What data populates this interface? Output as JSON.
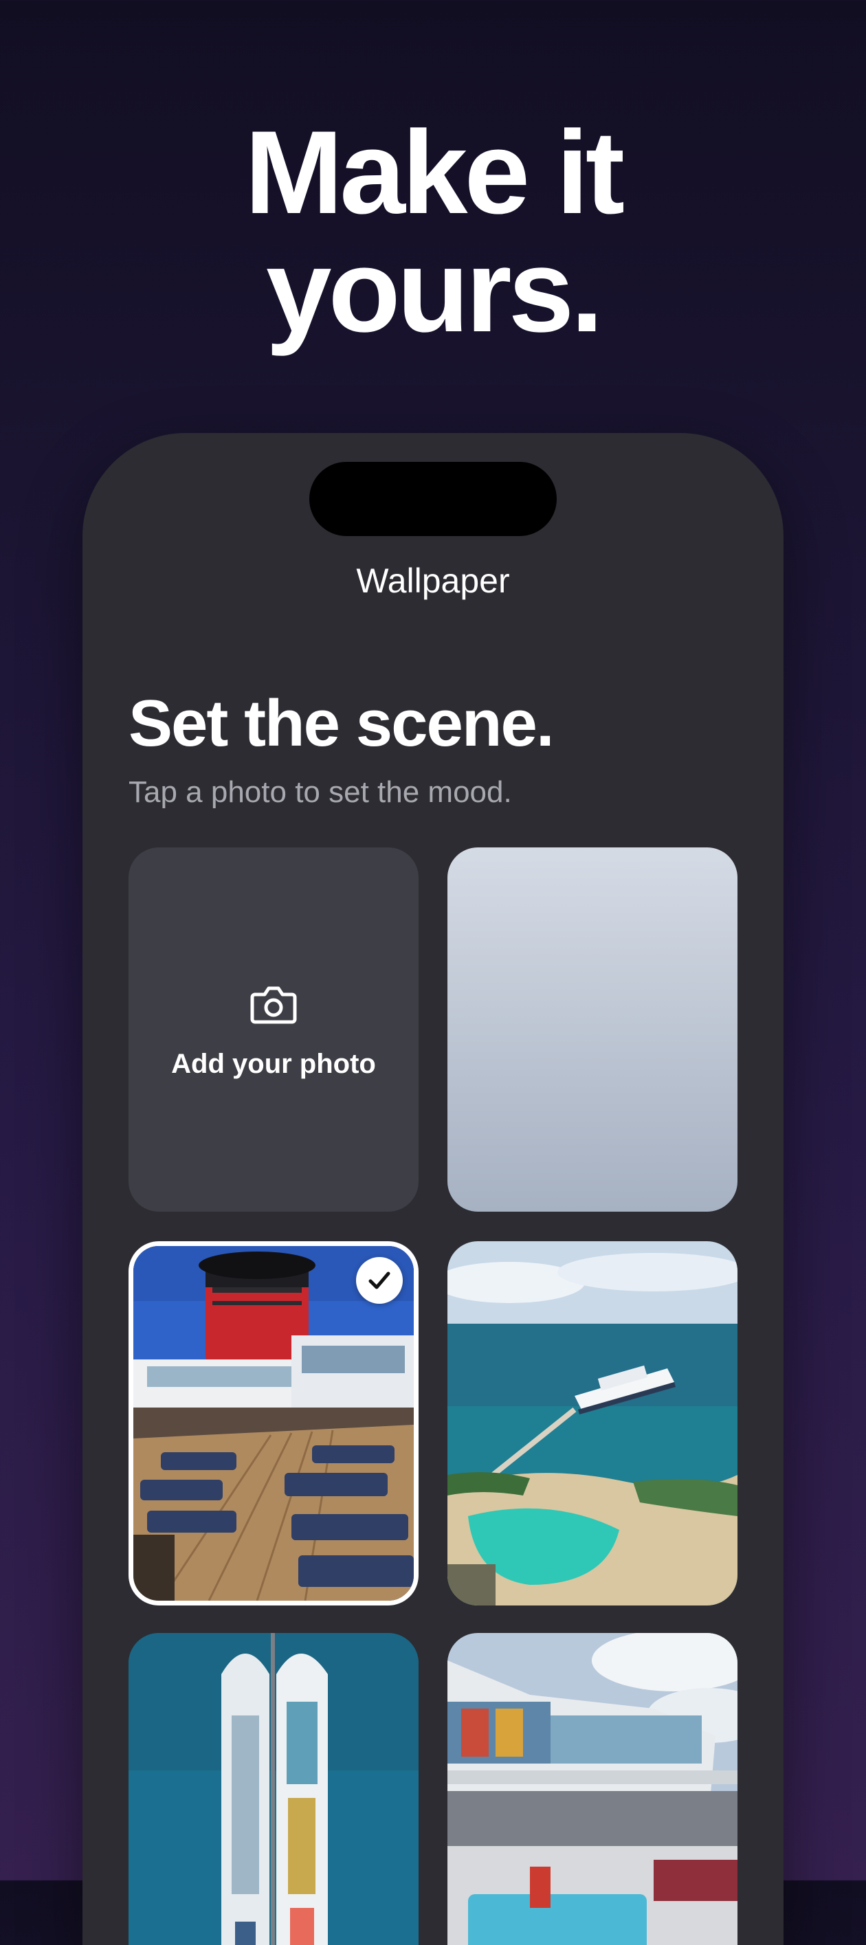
{
  "hero": {
    "line1": "Make it",
    "line2": "yours."
  },
  "screen": {
    "nav_title": "Wallpaper",
    "title": "Set the scene.",
    "subtitle": "Tap a photo to set the mood."
  },
  "tiles": [
    {
      "kind": "add-photo",
      "label": "Add your photo",
      "icon": "camera-icon"
    },
    {
      "kind": "gradient",
      "colors": [
        "#d5dbe5",
        "#a6b1c2"
      ]
    },
    {
      "kind": "photo",
      "subject": "cruise-ship-pool-deck",
      "selected": true,
      "badge_icon": "checkmark-icon"
    },
    {
      "kind": "photo",
      "subject": "cruise-ship-at-island-lagoon"
    },
    {
      "kind": "photo",
      "subject": "two-cruise-ships-aerial"
    },
    {
      "kind": "photo",
      "subject": "cruise-ship-stern-pool"
    }
  ],
  "colors": {
    "background_top": "#120e22",
    "background_bottom": "#35204f",
    "phone_surface": "#2c2c32",
    "add_tile": "#3e3e46",
    "selected_border": "#ffffff"
  }
}
